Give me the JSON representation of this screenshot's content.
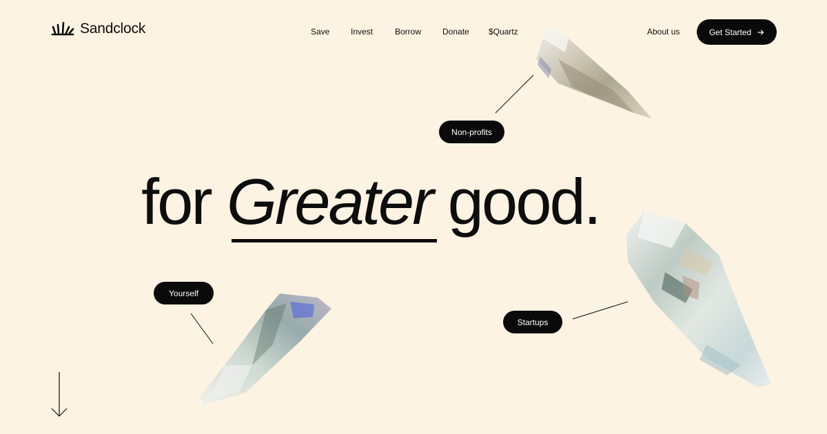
{
  "brand": {
    "name": "Sandclock"
  },
  "nav": {
    "items": [
      {
        "label": "Save"
      },
      {
        "label": "Invest"
      },
      {
        "label": "Borrow"
      },
      {
        "label": "Donate"
      },
      {
        "label": "$Quartz"
      }
    ],
    "about_label": "About us",
    "cta_label": "Get Started",
    "cta_icon": "arrow-right-icon"
  },
  "hero": {
    "word_1": "for",
    "word_2": "Greater",
    "word_3": "good."
  },
  "tags": {
    "nonprofits": "Non-profits",
    "yourself": "Yourself",
    "startups": "Startups"
  },
  "icons": {
    "logo": "sand-burst-logo-icon",
    "scroll": "arrow-down-icon"
  },
  "colors": {
    "background": "#fdf3e3",
    "ink": "#0a0a0a",
    "pill_text": "#ffffff"
  }
}
